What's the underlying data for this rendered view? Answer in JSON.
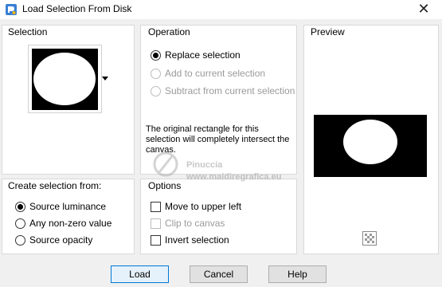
{
  "window": {
    "title": "Load Selection From Disk",
    "close_glyph": "✕"
  },
  "selection": {
    "label": "Selection"
  },
  "operation": {
    "label": "Operation",
    "options": [
      {
        "label": "Replace selection",
        "checked": true,
        "enabled": true
      },
      {
        "label": "Add to current selection",
        "checked": false,
        "enabled": false
      },
      {
        "label": "Subtract from current selection",
        "checked": false,
        "enabled": false
      }
    ],
    "info_text": "The original rectangle for this selection will completely intersect the canvas."
  },
  "preview": {
    "label": "Preview"
  },
  "create_from": {
    "label": "Create selection from:",
    "options": [
      {
        "label": "Source luminance",
        "checked": true
      },
      {
        "label": "Any non-zero value",
        "checked": false
      },
      {
        "label": "Source opacity",
        "checked": false
      }
    ]
  },
  "options": {
    "label": "Options",
    "items": [
      {
        "label": "Move to upper left",
        "checked": false,
        "enabled": true
      },
      {
        "label": "Clip to canvas",
        "checked": false,
        "enabled": false
      },
      {
        "label": "Invert selection",
        "checked": false,
        "enabled": true
      }
    ]
  },
  "buttons": {
    "load": "Load",
    "cancel": "Cancel",
    "help": "Help"
  },
  "watermark": {
    "line1": "Pinuccia",
    "line2": "www.maidiregrafica.eu"
  }
}
